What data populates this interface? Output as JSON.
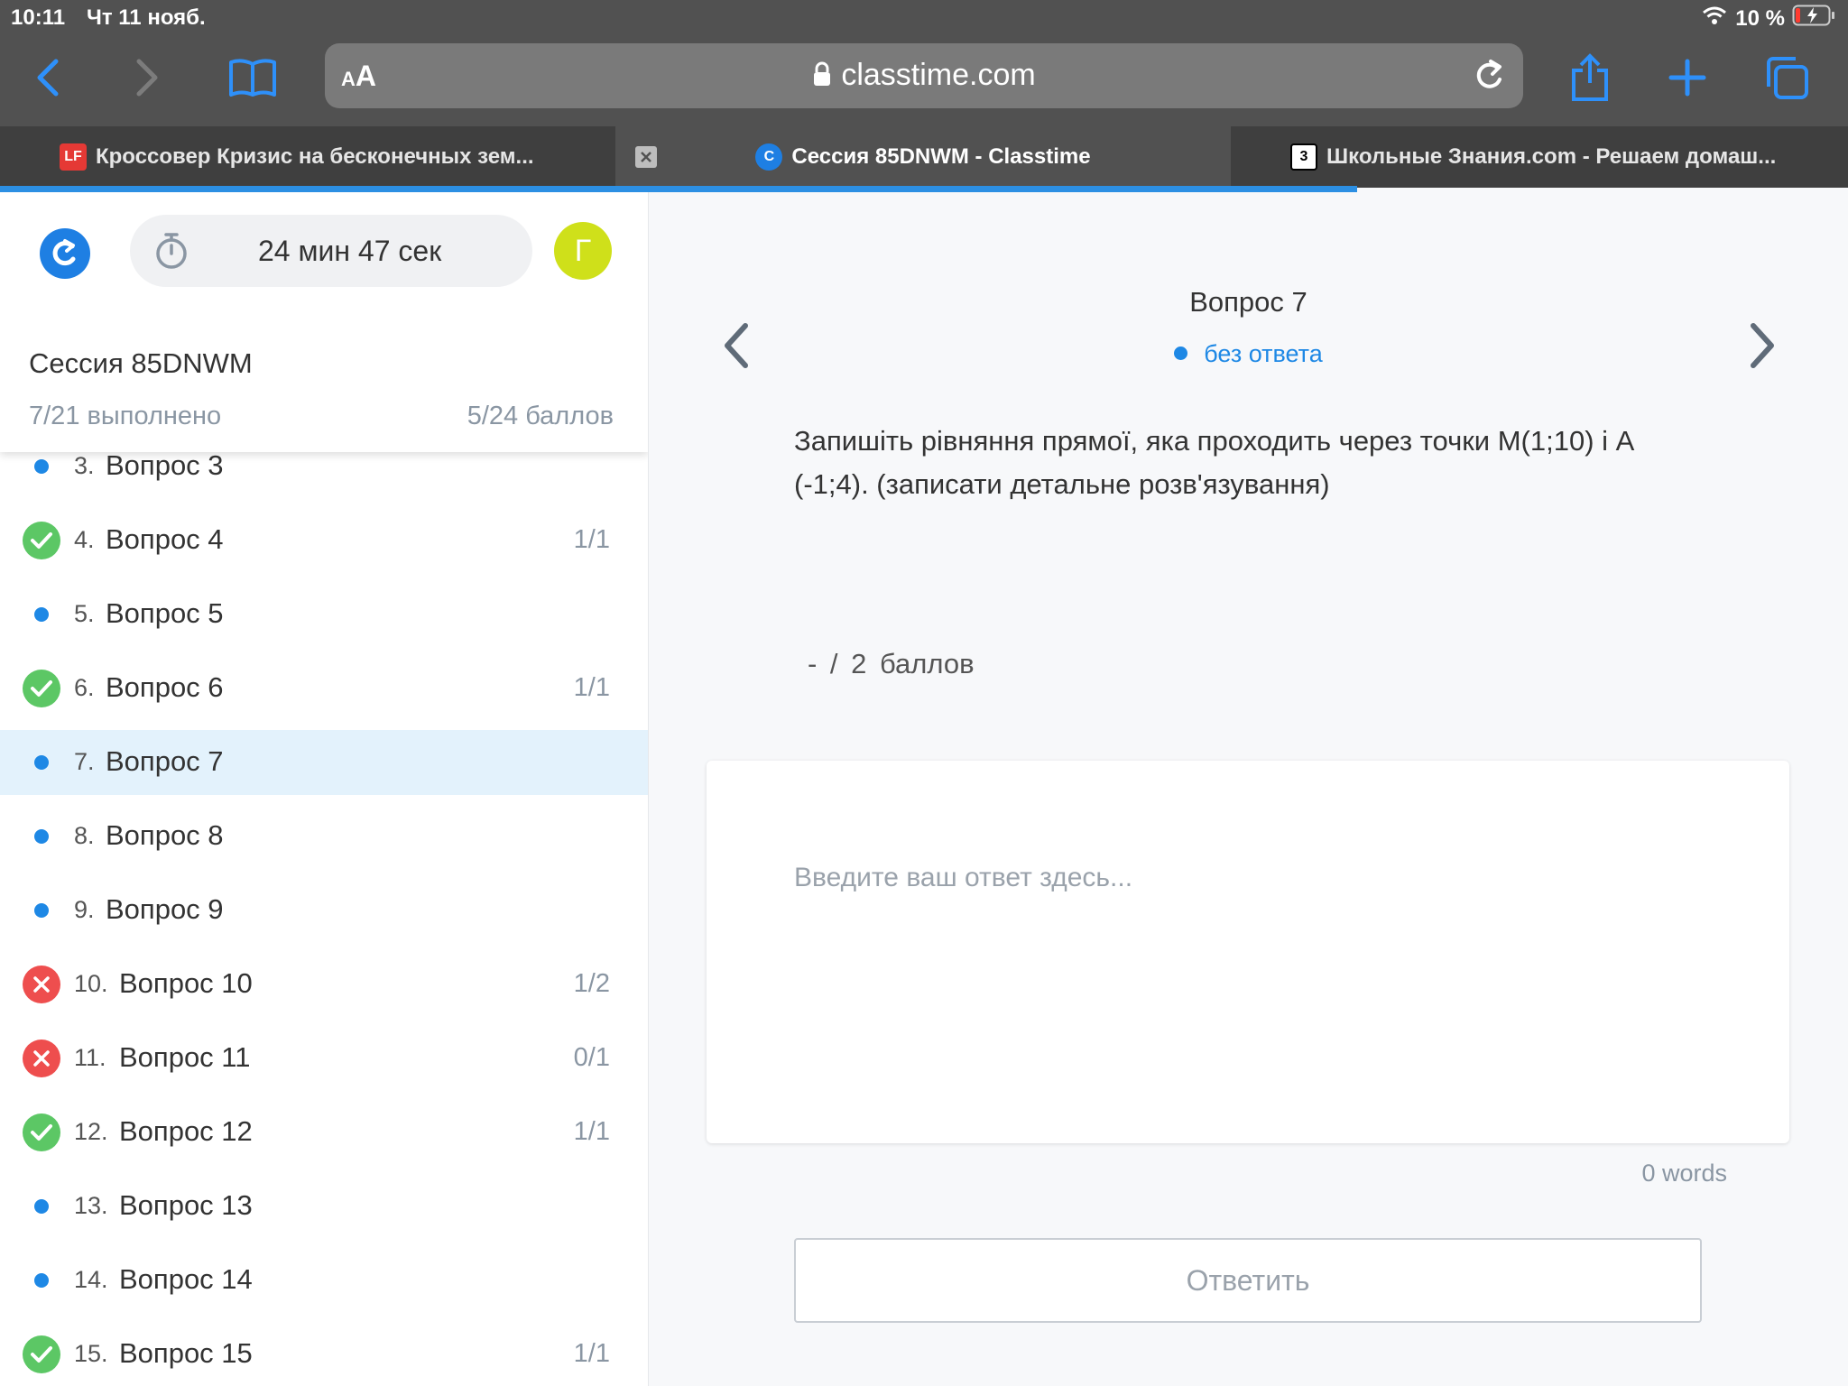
{
  "status_bar": {
    "time": "10:11",
    "date": "Чт 11 нояб.",
    "battery": "10 %"
  },
  "toolbar": {
    "aa_small": "A",
    "aa_big": "A",
    "url": "classtime.com"
  },
  "tabs": [
    {
      "favicon": "LF",
      "title": "Кроссовер Кризис на бесконечных зем..."
    },
    {
      "favicon": "C",
      "title": "Сессия 85DNWM - Classtime"
    },
    {
      "favicon": "3",
      "title": "Школьные Знания.com - Решаем домаш..."
    }
  ],
  "sidebar": {
    "timer": "24 мин 47 сек",
    "avatar_letter": "Г",
    "session_title": "Сессия 85DNWM",
    "completed": "7/21 выполнено",
    "points": "5/24 баллов",
    "questions": [
      {
        "num": "3.",
        "label": "Вопрос 3",
        "score": "",
        "state": "unanswered"
      },
      {
        "num": "4.",
        "label": "Вопрос 4",
        "score": "1/1",
        "state": "correct"
      },
      {
        "num": "5.",
        "label": "Вопрос 5",
        "score": "",
        "state": "unanswered"
      },
      {
        "num": "6.",
        "label": "Вопрос 6",
        "score": "1/1",
        "state": "correct"
      },
      {
        "num": "7.",
        "label": "Вопрос 7",
        "score": "",
        "state": "unanswered"
      },
      {
        "num": "8.",
        "label": "Вопрос 8",
        "score": "",
        "state": "unanswered"
      },
      {
        "num": "9.",
        "label": "Вопрос 9",
        "score": "",
        "state": "unanswered"
      },
      {
        "num": "10.",
        "label": "Вопрос 10",
        "score": "1/2",
        "state": "wrong"
      },
      {
        "num": "11.",
        "label": "Вопрос 11",
        "score": "0/1",
        "state": "wrong"
      },
      {
        "num": "12.",
        "label": "Вопрос 12",
        "score": "1/1",
        "state": "correct"
      },
      {
        "num": "13.",
        "label": "Вопрос 13",
        "score": "",
        "state": "unanswered"
      },
      {
        "num": "14.",
        "label": "Вопрос 14",
        "score": "",
        "state": "unanswered"
      },
      {
        "num": "15.",
        "label": "Вопрос 15",
        "score": "1/1",
        "state": "correct"
      }
    ]
  },
  "main": {
    "question_title": "Вопрос 7",
    "question_status": "без ответа",
    "question_text": "Запишіть рівняння прямої, яка проходить через точки M(1;10) і A (-1;4). (записати детальне розв'язування)",
    "points_text": "- / 2 баллов",
    "answer_placeholder": "Введите ваш ответ здесь...",
    "word_count": "0 words",
    "submit_label": "Ответить"
  },
  "colors": {
    "accent": "#1e88e5",
    "correct": "#5cc765",
    "wrong": "#ee4e4e",
    "active_row": "#e3f2fc"
  }
}
